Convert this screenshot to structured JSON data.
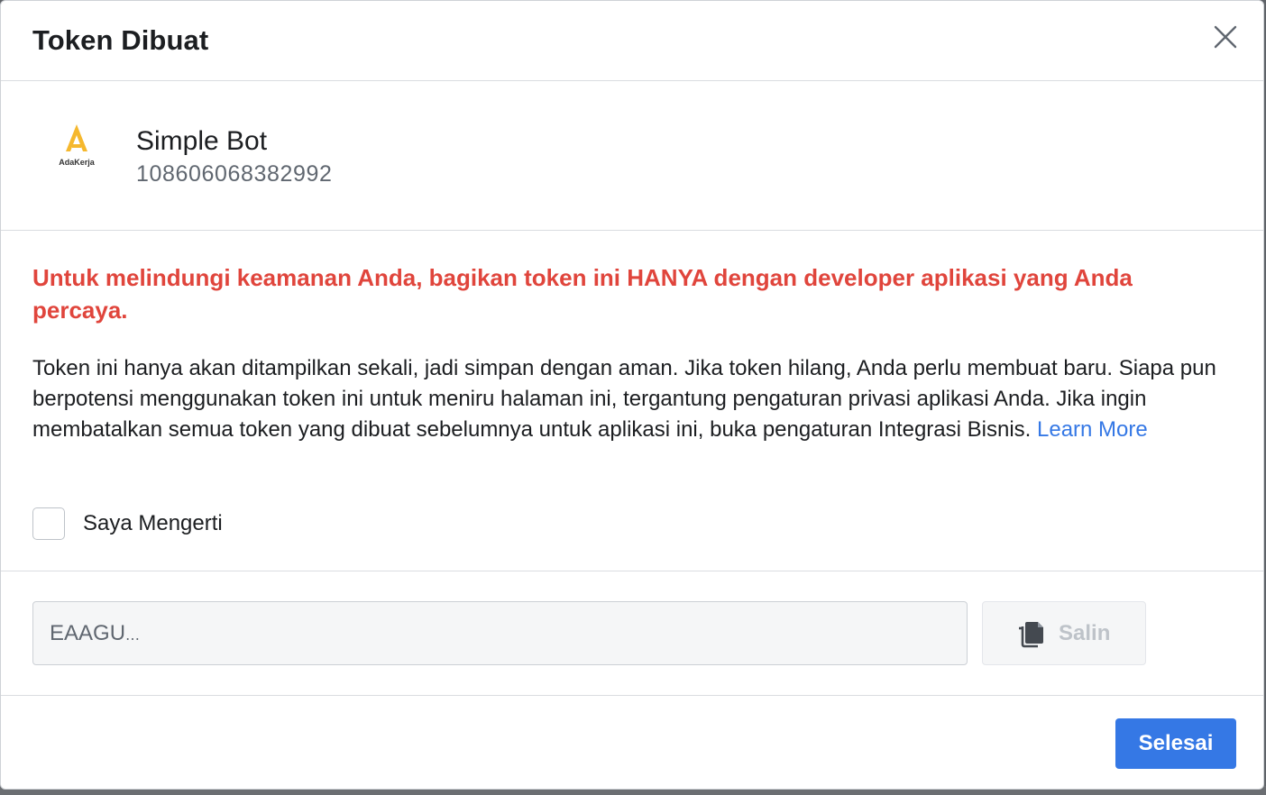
{
  "dialog": {
    "title": "Token Dibuat",
    "close_label": "close"
  },
  "app": {
    "name": "Simple Bot",
    "id": "108606068382992",
    "logo_text": "AdaKerja",
    "logo_color": "#f5b82e"
  },
  "warning": {
    "text": "Untuk melindungi keamanan Anda, bagikan token ini HANYA dengan developer aplikasi yang Anda percaya.",
    "color": "#e0453c"
  },
  "description": {
    "text": "Token ini hanya akan ditampilkan sekali, jadi simpan dengan aman. Jika token hilang, Anda perlu membuat baru. Siapa pun berpotensi menggunakan token ini untuk meniru halaman ini, tergantung pengaturan privasi aplikasi Anda. Jika ingin membatalkan semua token yang dibuat sebelumnya untuk aplikasi ini, buka pengaturan Integrasi Bisnis.",
    "link_label": "Learn More"
  },
  "acknowledge": {
    "label": "Saya Mengerti",
    "checked": false
  },
  "token": {
    "prefix": "EAAGU",
    "masked": "●●●●●●●●●●●●●●●●●●●●●●●●●●●●●●●●●●●●●●●●●●●●●●●●●●●●●●●●●●●●●●●●●●●●●●●●●●●●●●●",
    "copy_label": "Salin",
    "copy_enabled": false
  },
  "footer": {
    "done_label": "Selesai",
    "accent": "#3578e5"
  }
}
